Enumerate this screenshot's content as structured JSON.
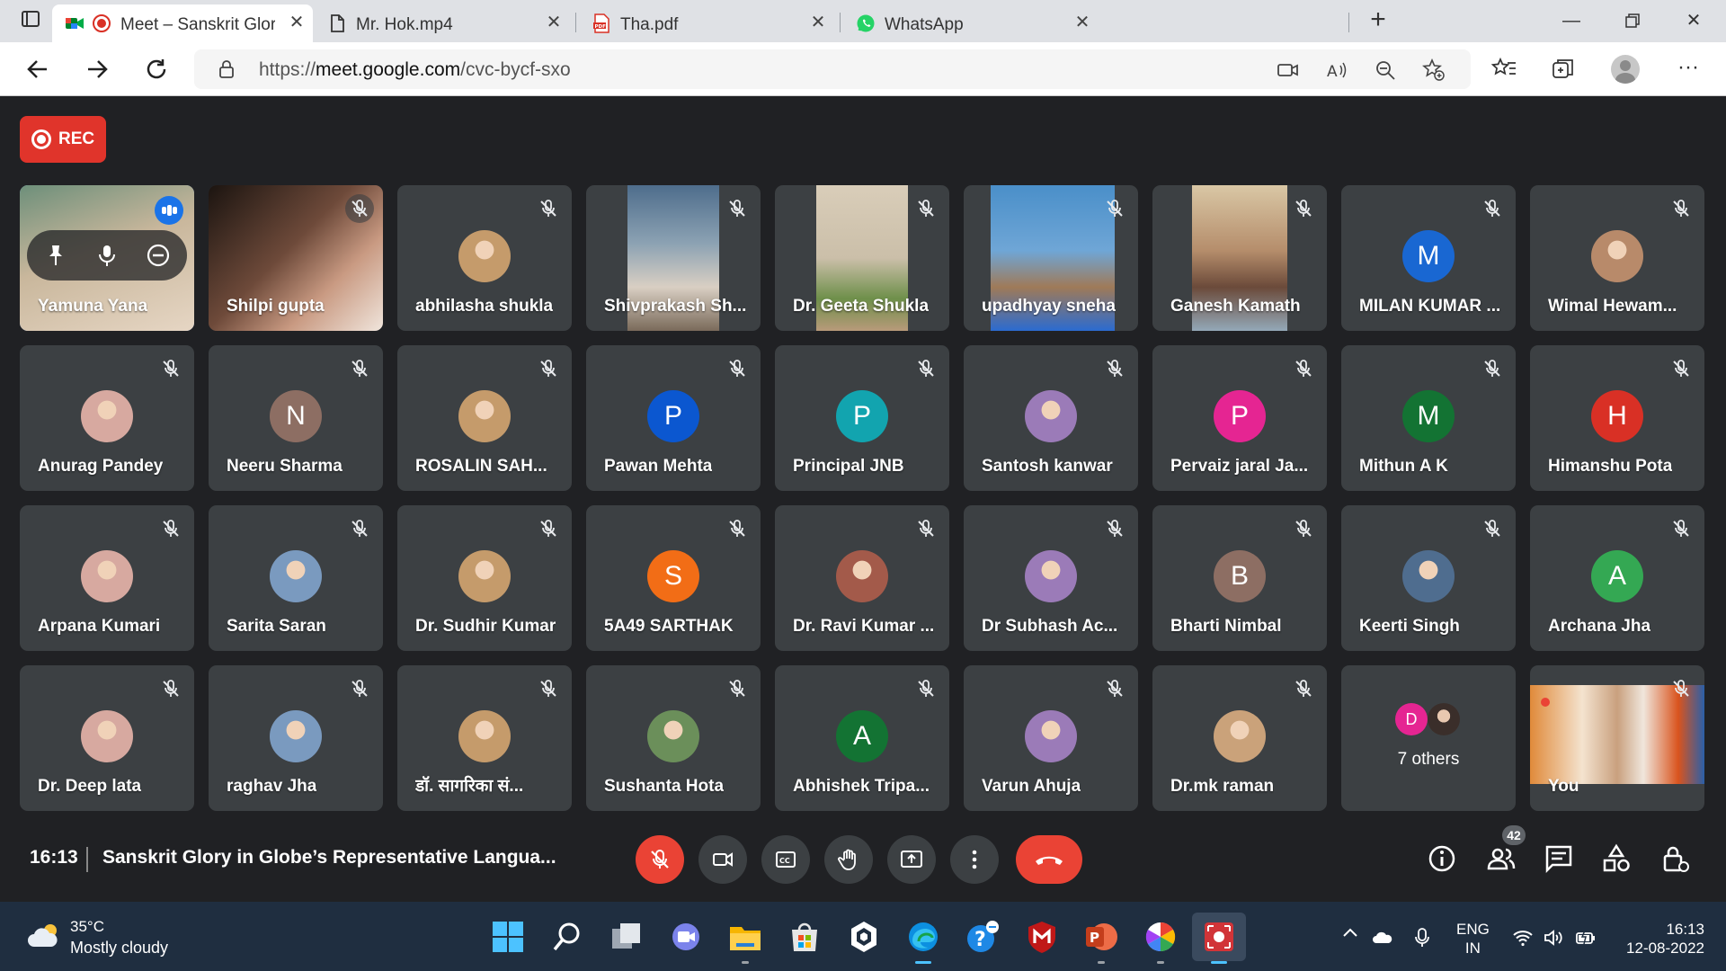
{
  "browser": {
    "tabs": [
      {
        "title": "Meet – Sanskrit Glory in Glo",
        "active": true,
        "icon": "google-meet-icon"
      },
      {
        "title": "Mr. Hok.mp4",
        "active": false,
        "icon": "file-icon"
      },
      {
        "title": "Tha.pdf",
        "active": false,
        "icon": "pdf-icon"
      },
      {
        "title": "WhatsApp",
        "active": false,
        "icon": "whatsapp-icon"
      }
    ],
    "url_prefix": "https://",
    "url_host": "meet.google.com",
    "url_path": "/cvc-bycf-sxo"
  },
  "meet": {
    "rec_label": "REC",
    "clock": "16:13",
    "title": "Sanskrit Glory in Globe’s Representative Langua...",
    "people_count": "42",
    "you_label": "You",
    "others_label": "7 others",
    "others_initial": "D",
    "participants": [
      {
        "name": "Yamuna Yana",
        "kind": "video"
      },
      {
        "name": "Shilpi gupta",
        "kind": "video"
      },
      {
        "name": "abhilasha shukla",
        "kind": "photo"
      },
      {
        "name": "Shivprakash Sh...",
        "kind": "video"
      },
      {
        "name": "Dr. Geeta Shukla",
        "kind": "video"
      },
      {
        "name": "upadhyay sneha",
        "kind": "video"
      },
      {
        "name": "Ganesh Kamath",
        "kind": "video"
      },
      {
        "name": "MILAN KUMAR ...",
        "kind": "initial",
        "initial": "M",
        "color": "#1967d2"
      },
      {
        "name": "Wimal Hewam...",
        "kind": "photo"
      },
      {
        "name": "Anurag Pandey",
        "kind": "photo"
      },
      {
        "name": "Neeru Sharma",
        "kind": "initial",
        "initial": "N",
        "color": "#8d6e63"
      },
      {
        "name": "ROSALIN SAH...",
        "kind": "photo"
      },
      {
        "name": "Pawan Mehta",
        "kind": "initial",
        "initial": "P",
        "color": "#0b57d0"
      },
      {
        "name": "Principal JNB",
        "kind": "initial",
        "initial": "P",
        "color": "#12a4af"
      },
      {
        "name": "Santosh kanwar",
        "kind": "photo"
      },
      {
        "name": "Pervaiz jaral Ja...",
        "kind": "initial",
        "initial": "P",
        "color": "#e52592"
      },
      {
        "name": "Mithun A K",
        "kind": "initial",
        "initial": "M",
        "color": "#137333"
      },
      {
        "name": "Himanshu Pota",
        "kind": "initial",
        "initial": "H",
        "color": "#d93025"
      },
      {
        "name": "Arpana Kumari",
        "kind": "photo"
      },
      {
        "name": "Sarita Saran",
        "kind": "photo"
      },
      {
        "name": "Dr. Sudhir Kumar",
        "kind": "photo"
      },
      {
        "name": "5A49 SARTHAK",
        "kind": "initial",
        "initial": "S",
        "color": "#f26d16"
      },
      {
        "name": "Dr. Ravi Kumar ...",
        "kind": "photo"
      },
      {
        "name": "Dr Subhash Ac...",
        "kind": "photo"
      },
      {
        "name": "Bharti Nimbal",
        "kind": "initial",
        "initial": "B",
        "color": "#8d6e63"
      },
      {
        "name": "Keerti Singh",
        "kind": "photo"
      },
      {
        "name": "Archana Jha",
        "kind": "initial",
        "initial": "A",
        "color": "#34a853"
      },
      {
        "name": "Dr. Deep lata",
        "kind": "photo"
      },
      {
        "name": "raghav Jha",
        "kind": "photo"
      },
      {
        "name": "डॉ. सागरिका सं...",
        "kind": "photo"
      },
      {
        "name": "Sushanta Hota",
        "kind": "photo"
      },
      {
        "name": "Abhishek Tripa...",
        "kind": "initial",
        "initial": "A",
        "color": "#137333"
      },
      {
        "name": "Varun Ahuja",
        "kind": "photo"
      },
      {
        "name": "Dr.mk raman",
        "kind": "photo"
      }
    ]
  },
  "taskbar": {
    "temp": "35°C",
    "weather": "Mostly cloudy",
    "lang_1": "ENG",
    "lang_2": "IN",
    "time": "16:13",
    "date": "12-08-2022"
  }
}
